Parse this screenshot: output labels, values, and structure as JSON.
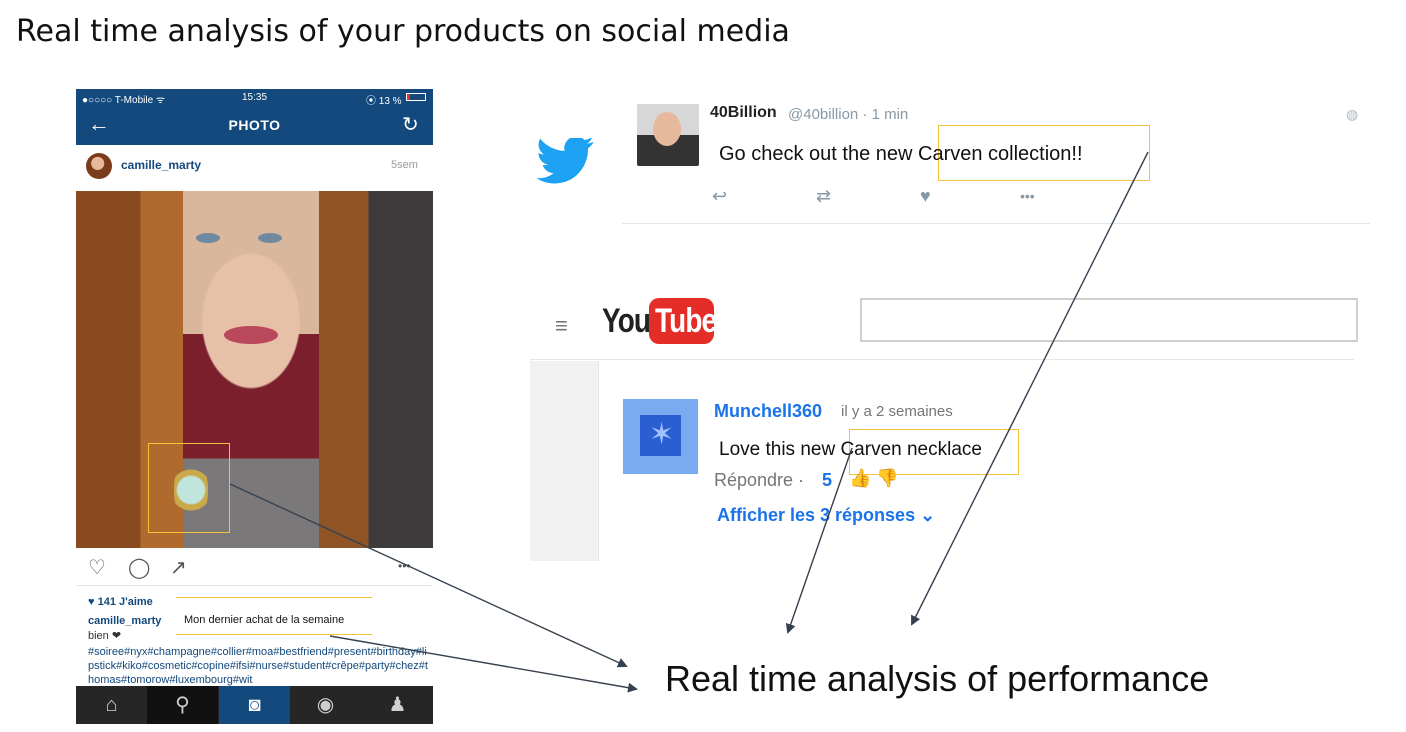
{
  "slide_title": "Real time analysis of your products on social media",
  "instagram": {
    "status": {
      "carrier": "●○○○○ T-Mobile ᯤ",
      "time": "15:35",
      "battery": "⦿ 13 %"
    },
    "header_title": "PHOTO",
    "back_icon": "←",
    "refresh_icon": "↻",
    "username": "camille_marty",
    "time_ago": "5sem",
    "action_icons": {
      "like": "♡",
      "comment": "◯",
      "share": "↗",
      "more": "•••"
    },
    "likes": "♥ 141 J'aime",
    "caption_user": "camille_marty",
    "caption_bien": "bien ❤",
    "caption_highlight": "Mon dernier achat de la semaine",
    "hashtags": "#soiree#nyx#champagne#collier#moa#bestfriend#present#birthday#lipstick#kiko#cosmetic#copine#ifsi#nurse#student#crêpe#party#chez#thomas#tomorow#luxembourg#wit",
    "tabs": [
      "⌂",
      "⚲",
      "◙",
      "◉",
      "♟"
    ],
    "brand_color": "#13497d"
  },
  "twitter": {
    "name": "40Billion",
    "handle": "@40billion · 1 min",
    "text": "Go check out the new Carven collection!!",
    "actions": {
      "reply": "↩",
      "retweet": "⇄",
      "like": "♥",
      "more": "•••"
    },
    "globe_icon": "◍",
    "brand_color": "#1da1f2"
  },
  "youtube": {
    "menu_icon": "≡",
    "logo_you": "You",
    "logo_tube": "Tube",
    "author": "Munchell360",
    "date": "il y a 2 semaines",
    "comment": "Love this new Carven necklace",
    "reply_label": "Répondre ·",
    "like_count": "5",
    "thumbs": "👍 👎",
    "show_replies": "Afficher les 3 réponses ⌄",
    "brand_color": "#e52d27"
  },
  "result_label": "Real time analysis of performance",
  "highlight_color": "#f2c23a"
}
